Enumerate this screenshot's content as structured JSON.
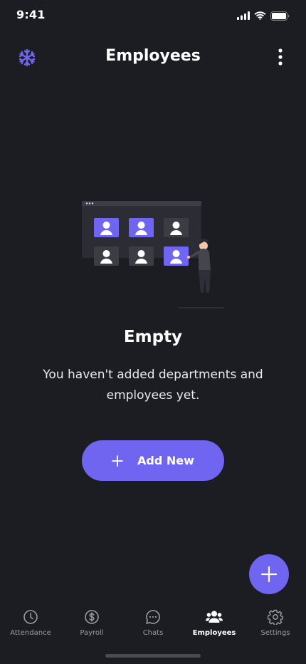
{
  "status_bar": {
    "time": "9:41"
  },
  "header": {
    "title": "Employees",
    "logo_icon": "snowflake-logo-icon",
    "menu_icon": "more-vertical-icon"
  },
  "empty_state": {
    "illustration_icon": "video-call-people-illustration",
    "title": "Empty",
    "message": "You haven't added departments and employees yet.",
    "button_label": "Add New",
    "button_icon": "plus-icon"
  },
  "fab": {
    "icon": "plus-icon"
  },
  "bottom_nav": {
    "active": "Employees",
    "items": [
      {
        "label": "Attendance",
        "icon": "clock-icon"
      },
      {
        "label": "Payroll",
        "icon": "dollar-circle-icon"
      },
      {
        "label": "Chats",
        "icon": "chat-bubble-icon"
      },
      {
        "label": "Employees",
        "icon": "users-icon"
      },
      {
        "label": "Settings",
        "icon": "gear-icon"
      }
    ]
  },
  "colors": {
    "background": "#1c1d22",
    "accent": "#7065f0",
    "text_primary": "#ffffff",
    "text_secondary": "#9a9ba3"
  }
}
